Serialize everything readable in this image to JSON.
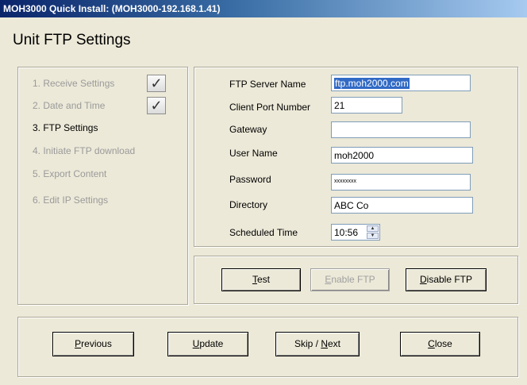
{
  "window": {
    "title": "MOH3000 Quick Install: (MOH3000-192.168.1.41)"
  },
  "page": {
    "title": "Unit FTP Settings"
  },
  "steps": [
    {
      "label": "1. Receive Settings",
      "state": "done"
    },
    {
      "label": "2. Date and Time",
      "state": "done"
    },
    {
      "label": "3. FTP Settings",
      "state": "current"
    },
    {
      "label": "4. Initiate FTP download",
      "state": "pending"
    },
    {
      "label": "5. Export Content",
      "state": "pending"
    },
    {
      "label": "6. Edit IP Settings",
      "state": "pending"
    }
  ],
  "form": {
    "ftp_server_name": {
      "label": "FTP Server Name",
      "value": "ftp.moh2000.com"
    },
    "client_port_number": {
      "label": "Client Port Number",
      "value": "21"
    },
    "gateway": {
      "label": "Gateway",
      "value": ""
    },
    "user_name": {
      "label": "User Name",
      "value": "moh2000"
    },
    "password": {
      "label": "Password",
      "value": "xxxxxxxx"
    },
    "directory": {
      "label": "Directory",
      "value": "ABC Co"
    },
    "scheduled_time": {
      "label": "Scheduled Time",
      "value": "10:56"
    }
  },
  "ftp_buttons": {
    "test": {
      "mnemonic": "T",
      "rest": "est"
    },
    "enable_ftp": {
      "mnemonic": "E",
      "rest": "nable FTP",
      "enabled": false
    },
    "disable_ftp": {
      "mnemonic": "D",
      "rest": "isable FTP"
    }
  },
  "nav_buttons": {
    "previous": {
      "mnemonic": "P",
      "rest": "revious"
    },
    "update": {
      "mnemonic": "U",
      "rest": "pdate"
    },
    "skip_next": {
      "prefix": "Skip / ",
      "mnemonic": "N",
      "rest": "ext"
    },
    "close": {
      "mnemonic": "C",
      "rest": "lose"
    }
  },
  "icons": {
    "check": "checkmark-icon",
    "spin_up": "spin-up-icon",
    "spin_down": "spin-down-icon"
  }
}
